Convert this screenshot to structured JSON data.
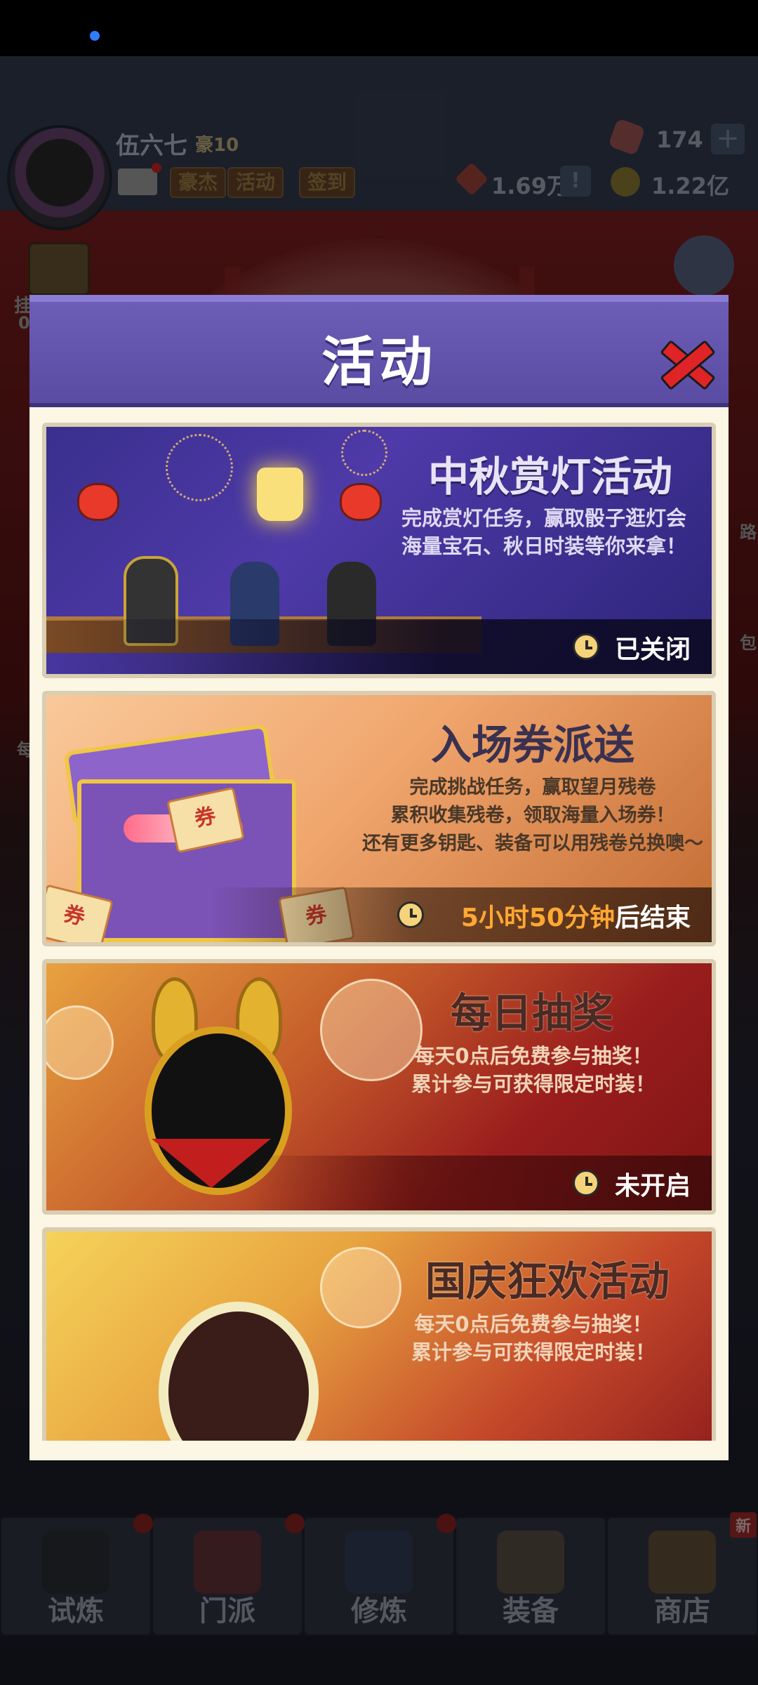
{
  "player": {
    "name": "伍六七",
    "level": "豪10"
  },
  "top_chips": [
    "豪杰",
    "活动",
    "签到"
  ],
  "resources": {
    "gems": "174",
    "red_currency": "1.69万",
    "gold": "1.22亿"
  },
  "top_buttons": {
    "plus": "+",
    "exclaim": "!"
  },
  "side_labels": {
    "left_1": "挂机奖励",
    "left_2": "0",
    "left_3": "每",
    "right_1": "路",
    "right_2": "包"
  },
  "modal": {
    "title": "活动",
    "cards": [
      {
        "title": "中秋赏灯活动",
        "desc": [
          "完成赏灯任务，赢取骰子逛灯会",
          "海量宝石、秋日时装等你来拿！"
        ],
        "status": "已关闭"
      },
      {
        "title": "入场券派送",
        "desc": [
          "完成挑战任务，赢取望月残卷",
          "累积收集残卷，领取海量入场券！",
          "还有更多钥匙、装备可以用残卷兑换噢～"
        ],
        "status_highlight": "5小时50分钟",
        "status_rest": "后结束",
        "coupon": "券"
      },
      {
        "title": "每日抽奖",
        "desc": [
          "每天0点后免费参与抽奖！",
          "累计参与可获得限定时装！"
        ],
        "status": "未开启"
      },
      {
        "title": "国庆狂欢活动",
        "desc": [
          "每天0点后免费参与抽奖！",
          "累计参与可获得限定时装！"
        ]
      }
    ]
  },
  "bottom_nav": [
    {
      "label": "试炼",
      "badge": "dot"
    },
    {
      "label": "门派",
      "badge": "dot"
    },
    {
      "label": "修炼",
      "badge": "dot"
    },
    {
      "label": "装备",
      "badge": ""
    },
    {
      "label": "商店",
      "badge": "新"
    }
  ],
  "colors": {
    "accent": "#5a4ca3",
    "close": "#e02326",
    "countdown": "#ffa832"
  }
}
